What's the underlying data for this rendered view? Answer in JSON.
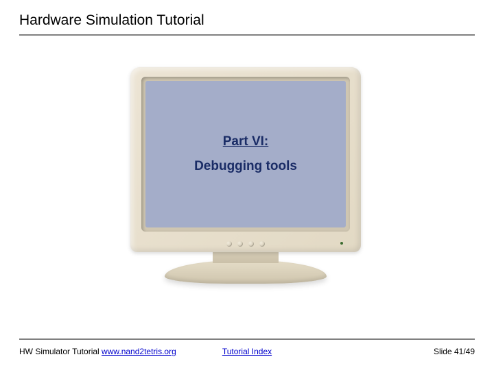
{
  "header": {
    "title": "Hardware Simulation Tutorial"
  },
  "screen": {
    "part": "Part VI:",
    "subtitle": "Debugging tools"
  },
  "footer": {
    "left_text": "HW Simulator Tutorial ",
    "left_link": "www.nand2tetris.org",
    "center_link": "Tutorial Index",
    "right": "Slide 41/49"
  }
}
